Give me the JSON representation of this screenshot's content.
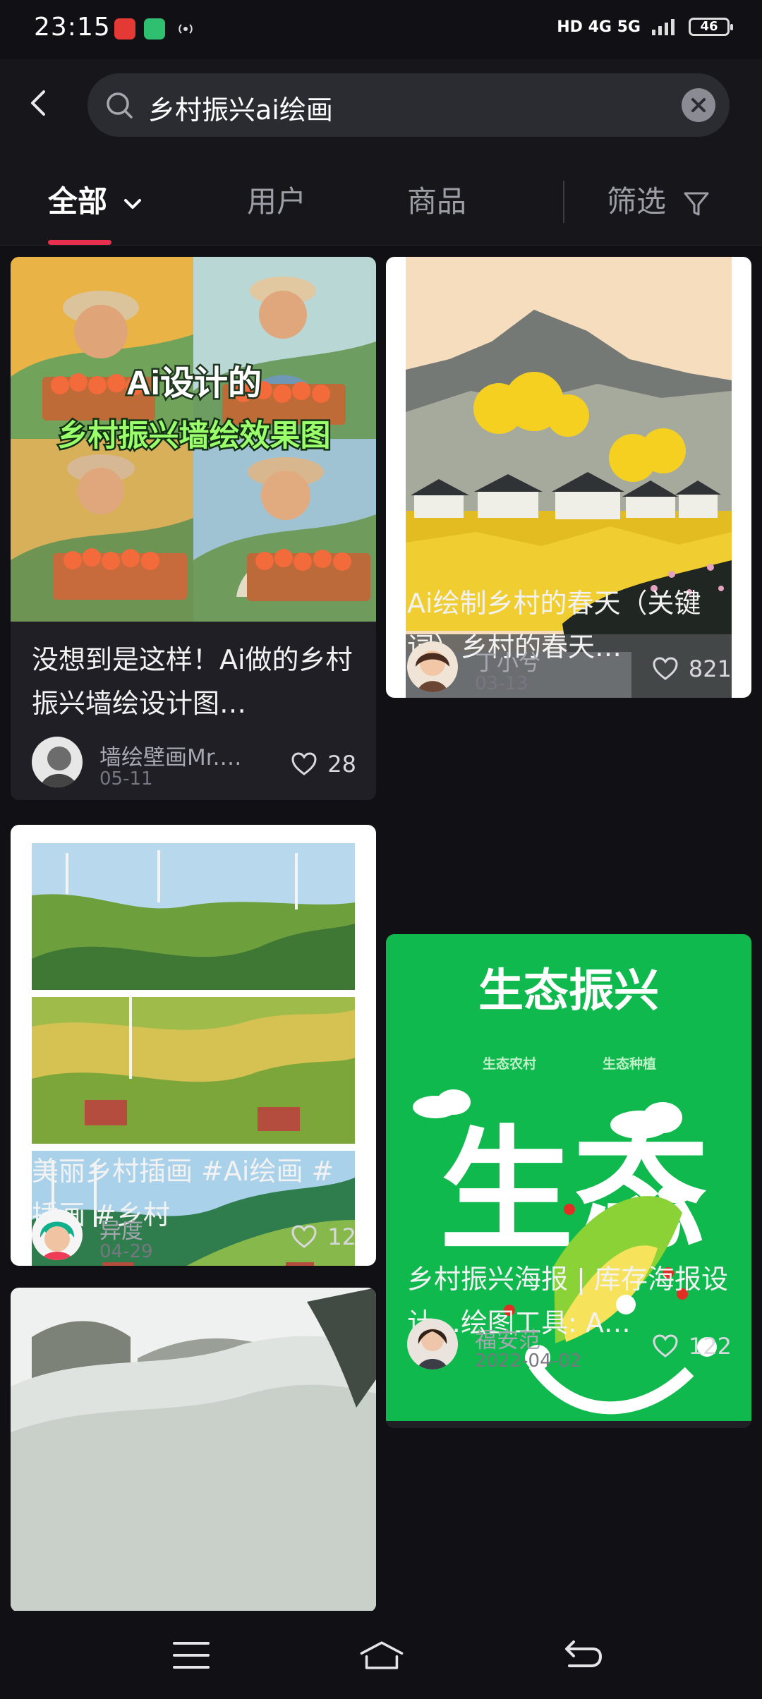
{
  "status": {
    "time": "23:15",
    "network": "HD 4G 5G",
    "battery": "46"
  },
  "search": {
    "query": "乡村振兴ai绘画"
  },
  "tabs": [
    {
      "label": "全部"
    },
    {
      "label": "用户"
    },
    {
      "label": "商品"
    },
    {
      "label": "筛选"
    }
  ],
  "cards": [
    {
      "title": "没想到是这样！Ai做的乡村振兴墙绘设计图…",
      "image_text_1": "Ai设计的",
      "image_text_2": "乡村振兴墙绘效果图",
      "author": "墙绘壁画Mr.…",
      "date": "05-11",
      "likes": "28"
    },
    {
      "title": "Ai绘制乡村的春天（关键词）乡村的春天…",
      "author": "丁小兮",
      "date": "03-13",
      "likes": "821"
    },
    {
      "title": "美丽乡村插画 #Ai绘画 #插画 #乡村",
      "author": "异度",
      "date": "04-29",
      "likes": "12"
    },
    {
      "title": "乡村振兴海报 | 库存海报设计…绘图工具: A…",
      "image_text_1": "生态振兴",
      "image_text_2": "生态农村",
      "image_text_3": "生态种植",
      "image_text_4": "生态",
      "author": "福安范",
      "date": "2022-04-02",
      "likes": "122"
    }
  ],
  "colors": {
    "accent": "#e8304e",
    "background": "#111115",
    "card": "#1f1f25"
  },
  "icons": [
    "back-icon",
    "search-icon",
    "close-icon",
    "chevron-down-icon",
    "filter-icon",
    "heart-icon",
    "menu-icon",
    "home-icon",
    "back-nav-icon"
  ]
}
